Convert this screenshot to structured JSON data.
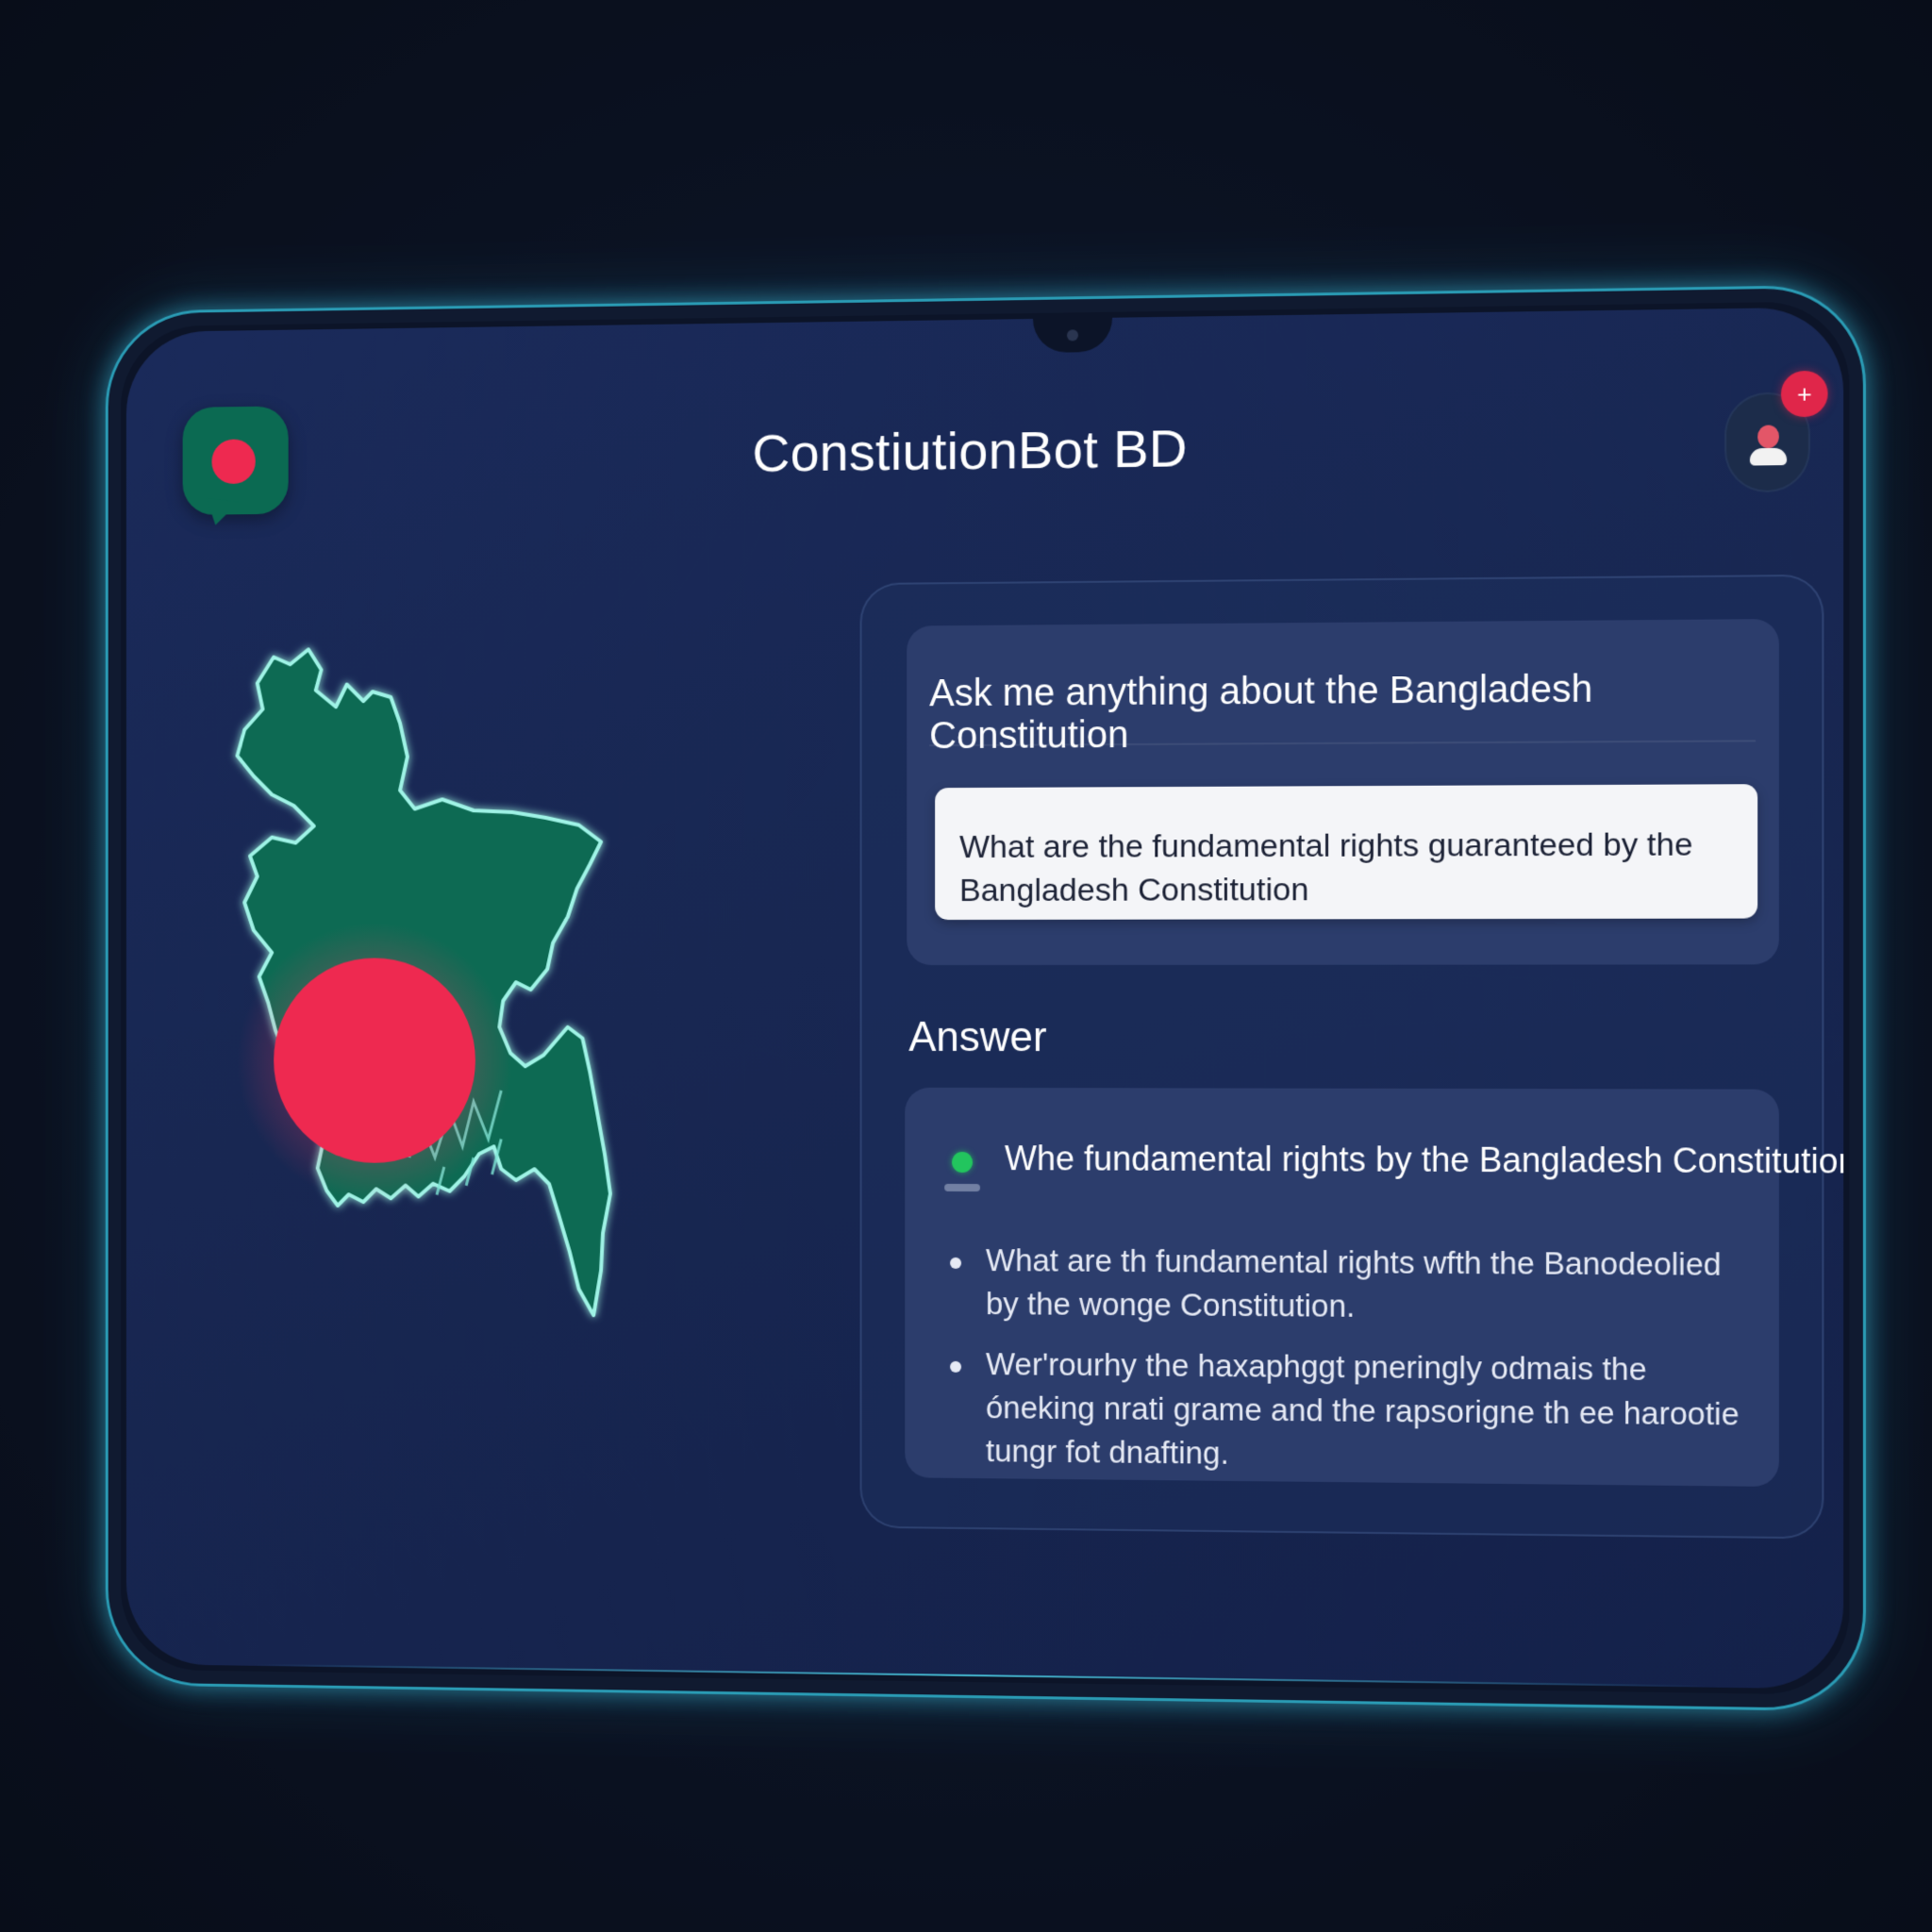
{
  "app": {
    "title": "ConstiutionBot BD"
  },
  "header": {
    "logo_icon": "chat-bubble-flag-icon",
    "profile_icon": "user-avatar-icon",
    "notification_badge": "+"
  },
  "colors": {
    "accent_green": "#0b6a52",
    "flag_red": "#ee2950",
    "screen_bg": "#182752",
    "card_bg": "#2c3d6c",
    "glow": "#2a9bb4"
  },
  "map": {
    "icon": "bangladesh-map-icon"
  },
  "ask": {
    "title": "Ask me anything about the Bangladesh Constitution",
    "query_value": "What are the fundamental rights guaranteed by the Bangladesh Constitution"
  },
  "answer": {
    "heading": "Answer",
    "lead": "Whe fundamental rights by the Bangladesh Constitution",
    "bullets": [
      "What are th fundamental rights wfth the Banodeolied by the wonge Constitution.",
      "Wer'rourhy the haxaphggt pneringly odmais the óneking nrati grame and the rapsorigne th ee harootie tungr fot dnafting."
    ]
  }
}
